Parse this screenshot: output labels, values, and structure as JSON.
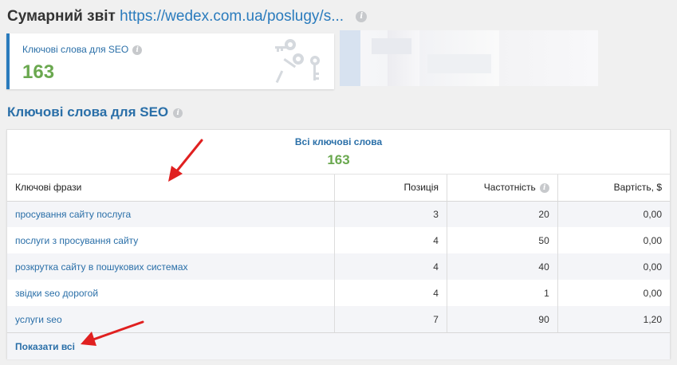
{
  "report": {
    "title_prefix": "Сумарний звіт",
    "url": "https://wedex.com.ua/poslugy/s..."
  },
  "metric_card": {
    "label": "Ключові слова для SEO",
    "value": "163",
    "icon": "keys-icon"
  },
  "section": {
    "title": "Ключові слова для SEO"
  },
  "panel": {
    "summary_label": "Всі ключові слова",
    "summary_value": "163",
    "columns": {
      "phrase": "Ключові фрази",
      "position": "Позиція",
      "frequency": "Частотність",
      "cost": "Вартість, $"
    },
    "rows": [
      {
        "phrase": "просування сайту послуга",
        "position": "3",
        "frequency": "20",
        "cost": "0,00"
      },
      {
        "phrase": "послуги з просування сайту",
        "position": "4",
        "frequency": "50",
        "cost": "0,00"
      },
      {
        "phrase": "розкрутка сайту в пошукових системах",
        "position": "4",
        "frequency": "40",
        "cost": "0,00"
      },
      {
        "phrase": "звідки seo дорогой",
        "position": "4",
        "frequency": "1",
        "cost": "0,00"
      },
      {
        "phrase": "услуги seo",
        "position": "7",
        "frequency": "90",
        "cost": "1,20"
      }
    ],
    "show_all": "Показати всі"
  },
  "colors": {
    "accent_blue": "#2a6fa8",
    "value_green": "#6aa84f",
    "annotation_red": "#e02020"
  }
}
